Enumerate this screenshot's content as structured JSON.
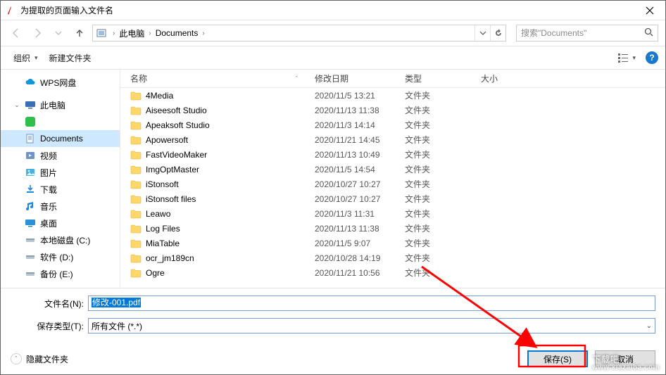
{
  "titlebar": {
    "title": "为提取的页面输入文件名"
  },
  "breadcrumb": {
    "root_chev": "›",
    "pc": "此电脑",
    "folder": "Documents"
  },
  "search": {
    "placeholder": "搜索\"Documents\""
  },
  "toolbar": {
    "organize": "组织",
    "new_folder": "新建文件夹"
  },
  "sidebar": {
    "wps": "WPS网盘",
    "pc": "此电脑",
    "documents": "Documents",
    "videos": "视频",
    "pictures": "图片",
    "downloads": "下载",
    "music": "音乐",
    "desktop": "桌面",
    "localdisk": "本地磁盘 (C:)",
    "soft": "软件 (D:)",
    "backup": "备份 (E:)"
  },
  "columns": {
    "name": "名称",
    "date": "修改日期",
    "type": "类型",
    "size": "大小"
  },
  "rows": [
    {
      "name": "4Media",
      "date": "2020/11/5 13:21",
      "type": "文件夹"
    },
    {
      "name": "Aiseesoft Studio",
      "date": "2020/11/13 11:38",
      "type": "文件夹"
    },
    {
      "name": "Apeaksoft Studio",
      "date": "2020/11/3 14:14",
      "type": "文件夹"
    },
    {
      "name": "Apowersoft",
      "date": "2020/11/21 14:45",
      "type": "文件夹"
    },
    {
      "name": "FastVideoMaker",
      "date": "2020/11/13 10:49",
      "type": "文件夹"
    },
    {
      "name": "ImgOptMaster",
      "date": "2020/11/5 14:54",
      "type": "文件夹"
    },
    {
      "name": "iStonsoft",
      "date": "2020/10/27 10:27",
      "type": "文件夹"
    },
    {
      "name": "iStonsoft files",
      "date": "2020/10/27 10:27",
      "type": "文件夹"
    },
    {
      "name": "Leawo",
      "date": "2020/11/3 11:31",
      "type": "文件夹"
    },
    {
      "name": "Log Files",
      "date": "2020/11/13 11:38",
      "type": "文件夹"
    },
    {
      "name": "MiaTable",
      "date": "2020/11/5 9:07",
      "type": "文件夹"
    },
    {
      "name": "ocr_jm189cn",
      "date": "2020/10/28 14:19",
      "type": "文件夹"
    },
    {
      "name": "Ogre",
      "date": "2020/11/21 10:56",
      "type": "文件夹"
    }
  ],
  "fields": {
    "filename_label": "文件名(N):",
    "filename_value": "修改-001.pdf",
    "filetype_label": "保存类型(T):",
    "filetype_value": "所有文件 (*.*)"
  },
  "footer": {
    "hide_folders": "隐藏文件夹",
    "save": "保存(S)",
    "cancel": "取消"
  },
  "watermark": {
    "main": "下载吧",
    "sub": "www.xiazaiba.com"
  }
}
